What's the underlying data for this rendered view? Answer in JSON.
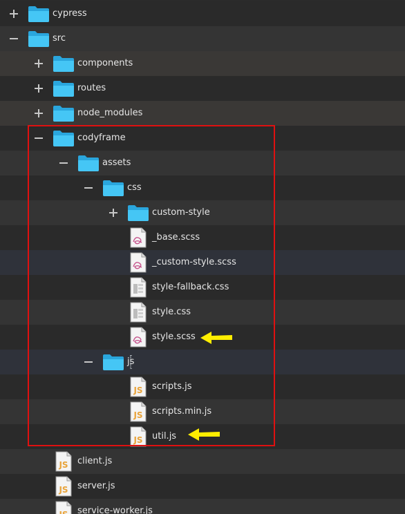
{
  "tree": {
    "items": [
      {
        "name": "cypress",
        "type": "folder",
        "state": "collapsed"
      },
      {
        "name": "src",
        "type": "folder",
        "state": "expanded"
      },
      {
        "name": "components",
        "type": "folder",
        "state": "collapsed"
      },
      {
        "name": "routes",
        "type": "folder",
        "state": "collapsed"
      },
      {
        "name": "node_modules",
        "type": "folder",
        "state": "collapsed"
      },
      {
        "name": "codyframe",
        "type": "folder",
        "state": "expanded"
      },
      {
        "name": "assets",
        "type": "folder",
        "state": "expanded"
      },
      {
        "name": "css",
        "type": "folder",
        "state": "expanded"
      },
      {
        "name": "custom-style",
        "type": "folder",
        "state": "collapsed"
      },
      {
        "name": "_base.scss",
        "type": "file",
        "icon": "sass-file-icon"
      },
      {
        "name": "_custom-style.scss",
        "type": "file",
        "icon": "sass-file-icon"
      },
      {
        "name": "style-fallback.css",
        "type": "file",
        "icon": "css-file-icon"
      },
      {
        "name": "style.css",
        "type": "file",
        "icon": "css-file-icon"
      },
      {
        "name": "style.scss",
        "type": "file",
        "icon": "sass-file-icon"
      },
      {
        "name": "js",
        "type": "folder",
        "state": "expanded"
      },
      {
        "name": "scripts.js",
        "type": "file",
        "icon": "js-file-icon"
      },
      {
        "name": "scripts.min.js",
        "type": "file",
        "icon": "js-file-icon"
      },
      {
        "name": "util.js",
        "type": "file",
        "icon": "js-file-icon"
      },
      {
        "name": "client.js",
        "type": "file",
        "icon": "js-file-icon"
      },
      {
        "name": "server.js",
        "type": "file",
        "icon": "js-file-icon"
      },
      {
        "name": "service-worker.js",
        "type": "file",
        "icon": "js-file-icon"
      }
    ]
  },
  "annotations": {
    "box_color": "#e01010",
    "arrow_color": "#ffee00",
    "arrow_targets": [
      "style.scss",
      "util.js"
    ]
  },
  "colors": {
    "folder": "#3cc0f0",
    "text": "#e6e6e6"
  }
}
